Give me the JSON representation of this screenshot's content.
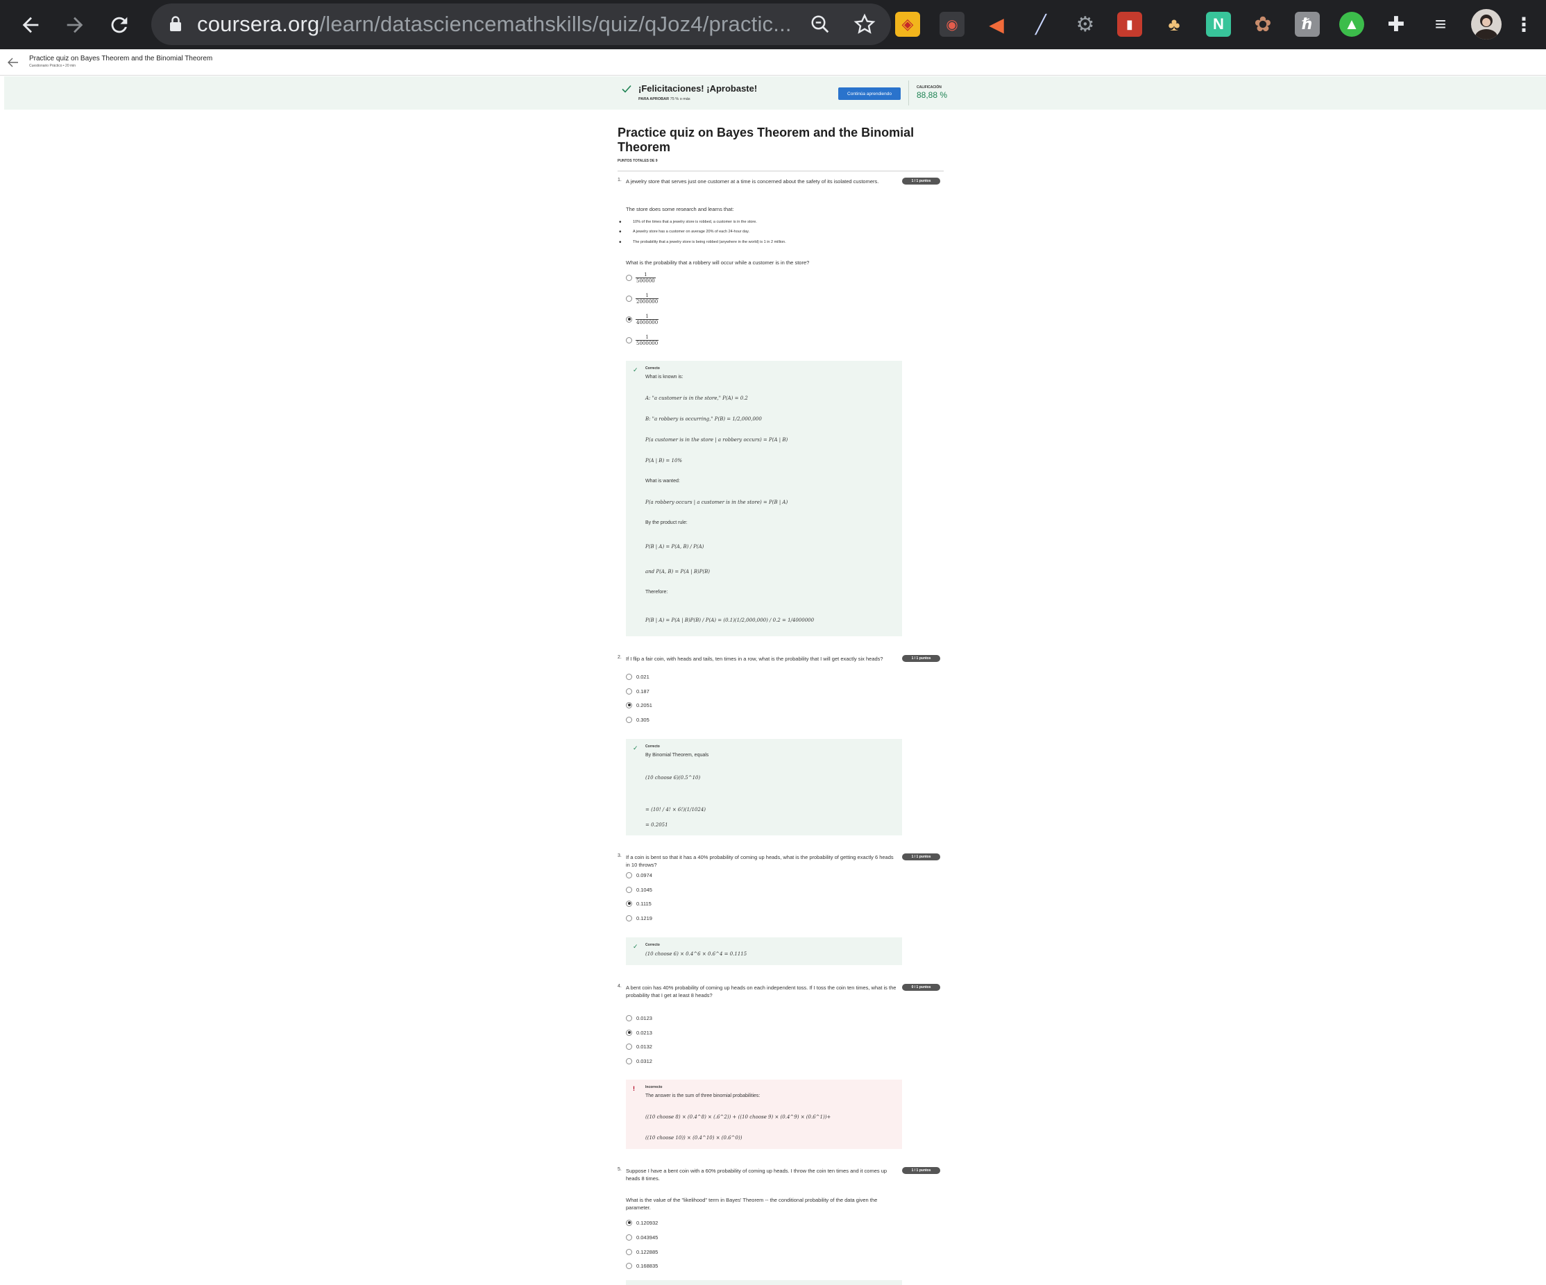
{
  "browser": {
    "url_host": "coursera.org",
    "url_path": "/learn/datasciencemathskills/quiz/qJoz4/practic..."
  },
  "course": {
    "title": "Practice quiz on Bayes Theorem and the Binomial Theorem",
    "subtitle": "Cuestionario Práctico • 20 min"
  },
  "banner": {
    "title": "¡Felicitaciones! ¡Aprobaste!",
    "pass_label": "PARA APROBAR",
    "pass_value": "75 % o más",
    "button": "Continúa aprendiendo",
    "grade_label": "CALIFICACIÓN",
    "grade_value": "88,88 %"
  },
  "quiz": {
    "title": "Practice quiz on Bayes Theorem and the Binomial Theorem",
    "total_points": "PUNTOS TOTALES DE 9"
  },
  "q1": {
    "num": "1.",
    "text": "A jewelry store that serves just one customer at a time is concerned about the safety of its isolated customers.",
    "points": "1 / 1 puntos",
    "intro": "The store does some research and learns that:",
    "bullets": [
      "10% of the times that a jewelry store is robbed, a customer is in the store.",
      "A jewelry store has a customer on average 20% of each 24-hour day.",
      "The probability that a jewelry store is being robbed (anywhere in the world) is 1 in 2 million."
    ],
    "question": "What is the probability that a robbery will occur while a customer is in the store?",
    "options": [
      {
        "num": "1",
        "den": "500000"
      },
      {
        "num": "1",
        "den": "2000000"
      },
      {
        "num": "1",
        "den": "4000000"
      },
      {
        "num": "1",
        "den": "5000000"
      }
    ],
    "fb_head": "Correcto",
    "fb": [
      "What is known is:",
      "A: \"a customer is in the store,\" P(A) = 0.2",
      "B: \"a robbery is occurring,\" P(B) = 1/2,000,000",
      "P(a customer is in the store | a robbery occurs) = P(A | B)",
      "P(A | B) = 10%",
      "What is wanted:",
      "P(a robbery occurs | a customer is in the store) = P(B | A)",
      "By the product rule:",
      "P(B | A) = P(A, B) / P(A)",
      "and P(A, B) = P(A | B)P(B)",
      "Therefore:",
      "P(B | A) = P(A | B)P(B) / P(A) = (0.1)(1/2,000,000) / 0.2 = 1/4000000"
    ]
  },
  "q2": {
    "num": "2.",
    "text": "If I flip a fair coin, with heads and tails, ten times in a row, what is the probability that I will get exactly six heads?",
    "points": "1 / 1 puntos",
    "options": [
      "0.021",
      "0.187",
      "0.2051",
      "0.305"
    ],
    "fb_head": "Correcto",
    "fb": [
      "By Binomial Theorem, equals",
      "(10 choose 6)(0.5^10)",
      "= (10! / 4! × 6!)(1/1024)",
      "= 0.2051"
    ]
  },
  "q3": {
    "num": "3.",
    "text": "If a coin is bent so that it has a 40% probability of coming up heads, what is the probability of getting exactly 6 heads in 10 throws?",
    "points": "1 / 1 puntos",
    "options": [
      "0.0974",
      "0.1045",
      "0.1115",
      "0.1219"
    ],
    "fb_head": "Correcto",
    "fb": [
      "(10 choose 6) × 0.4^6 × 0.6^4 = 0.1115"
    ]
  },
  "q4": {
    "num": "4.",
    "text": "A bent coin has 40% probability of coming up heads on each independent toss. If I toss the coin ten times, what is the probability that I get at least 8 heads?",
    "points": "0 / 1 puntos",
    "options": [
      "0.0123",
      "0.0213",
      "0.0132",
      "0.0312"
    ],
    "fb_head": "Incorrecto",
    "fb": [
      "The answer is the sum of three binomial probabilities:",
      "((10 choose 8) × (0.4^8) × (.6^2)) + ((10 choose 9) × (0.4^9) × (0.6^1))+",
      "((10 choose 10)) × (0.4^10) × (0.6^0))"
    ]
  },
  "q5": {
    "num": "5.",
    "text": "Suppose I have a bent coin with a 60% probability of coming up heads. I throw the coin ten times and it comes up heads 8 times.",
    "points": "1 / 1 puntos",
    "question": "What is the value of the \"likelihood\" term in Bayes' Theorem -- the conditional probability of the data given the parameter.",
    "options": [
      "0.120932",
      "0.043945",
      "0.122885",
      "0.168835"
    ]
  }
}
